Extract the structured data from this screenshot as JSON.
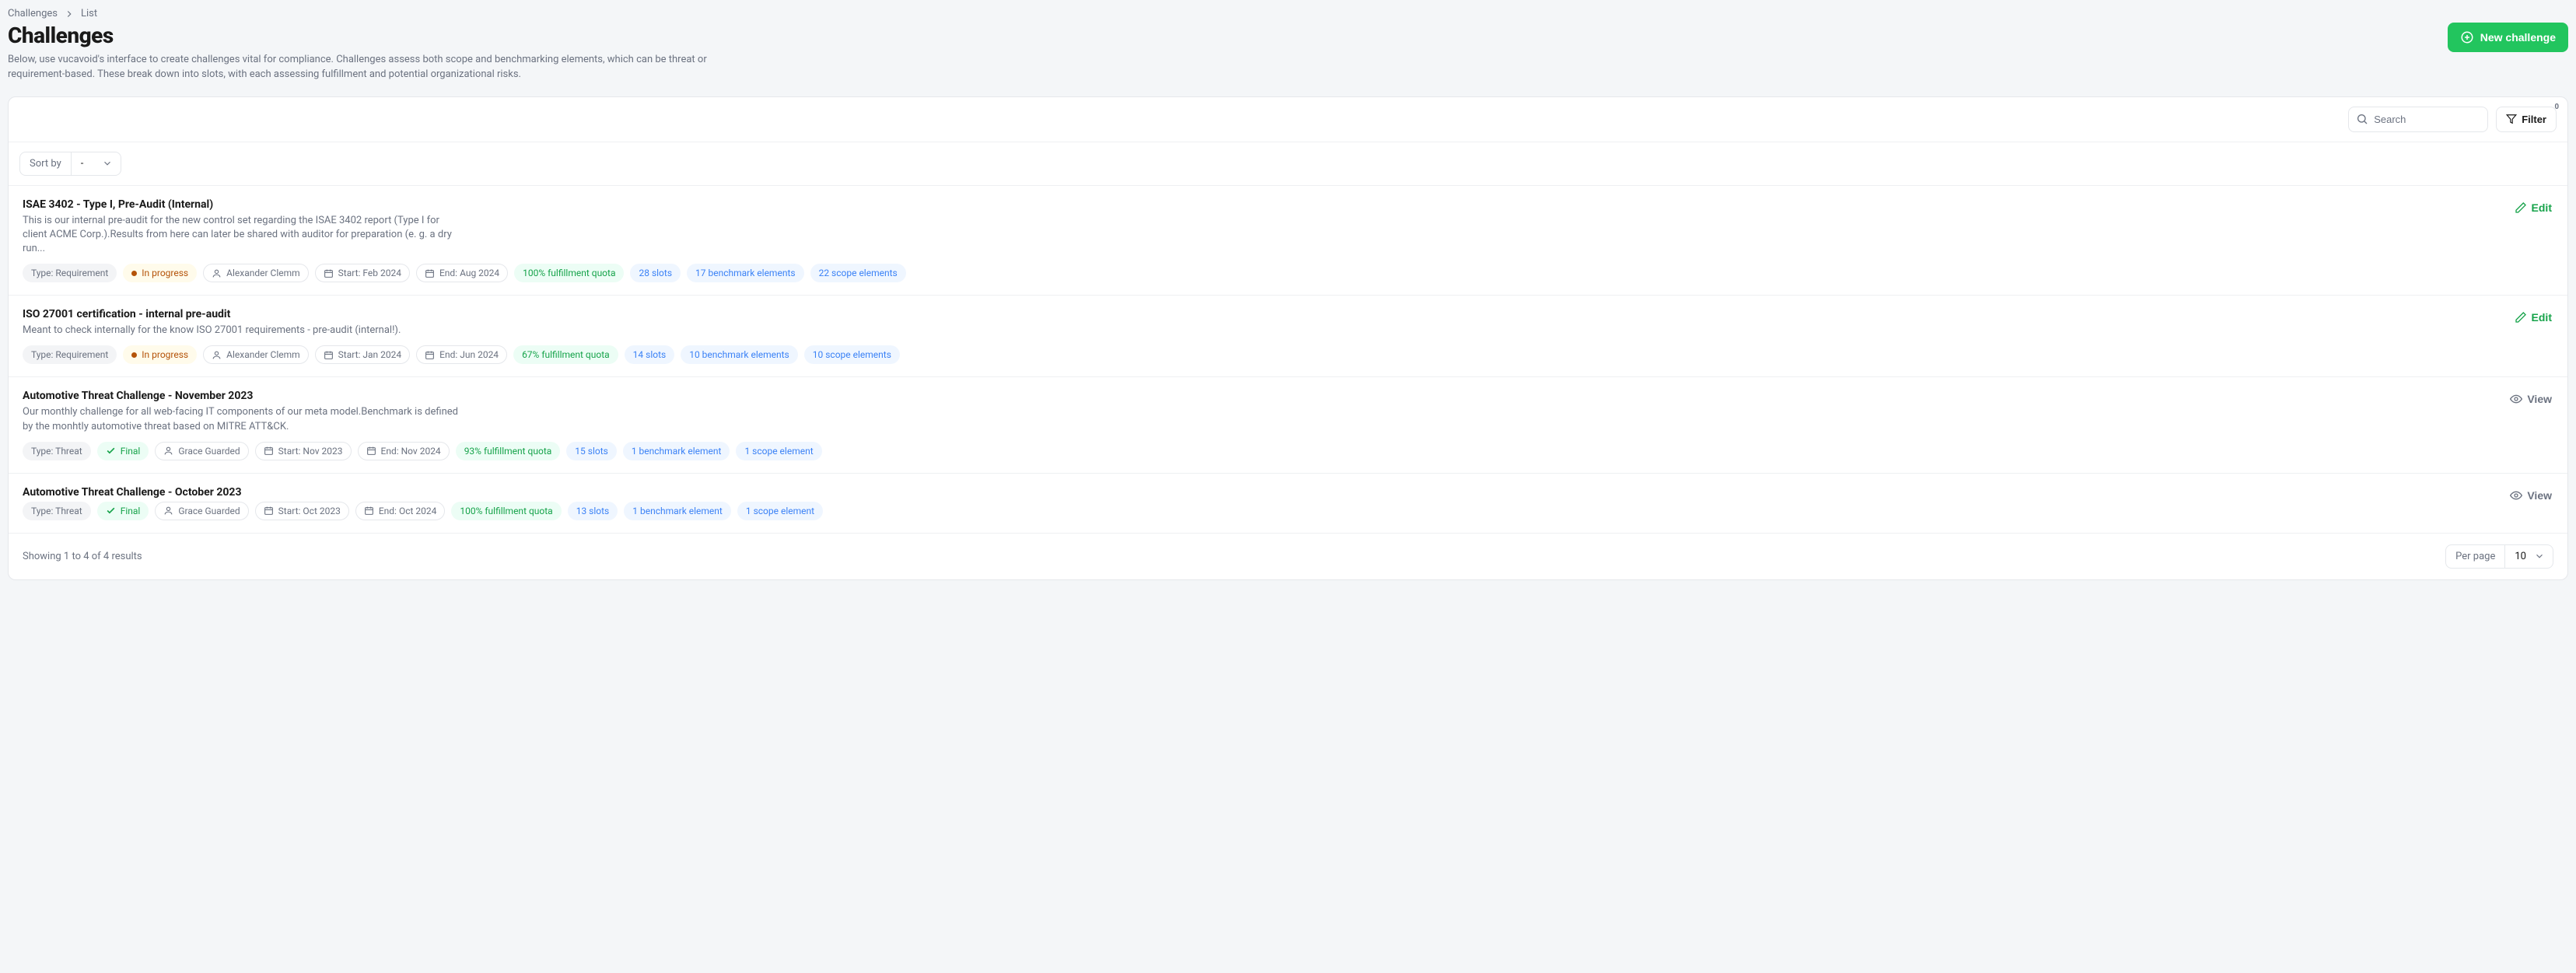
{
  "breadcrumb": {
    "root": "Challenges",
    "current": "List"
  },
  "header": {
    "title": "Challenges",
    "description": "Below, use vucavoid's interface to create challenges vital for compliance. Challenges assess both scope and benchmarking elements, which can be threat or requirement-based. These break down into slots, with each assessing fulfillment and potential organizational risks.",
    "new_button": "New challenge"
  },
  "toolbar": {
    "search_placeholder": "Search",
    "filter_label": "Filter",
    "filter_count": "0"
  },
  "sort": {
    "label": "Sort by",
    "selected": "-"
  },
  "actions": {
    "edit": "Edit",
    "view": "View"
  },
  "items": [
    {
      "title": "ISAE 3402 - Type I, Pre-Audit (Internal)",
      "description": "This is our internal pre-audit for the new control set regarding the ISAE 3402 report (Type I for client ACME Corp.).Results from here can later be shared with auditor for preparation (e. g. a dry run...",
      "type_label": "Type: Requirement",
      "status": {
        "kind": "progress",
        "label": "In progress"
      },
      "author": "Alexander Clemm",
      "start": "Start: Feb 2024",
      "end": "End: Aug 2024",
      "quota": "100% fulfillment quota",
      "slots": "28 slots",
      "benchmark": "17 benchmark elements",
      "scope": "22 scope elements",
      "action": "edit"
    },
    {
      "title": "ISO 27001 certification - internal pre-audit",
      "description": "Meant to check internally for the know ISO 27001 requirements - pre-audit (internal!).",
      "type_label": "Type: Requirement",
      "status": {
        "kind": "progress",
        "label": "In progress"
      },
      "author": "Alexander Clemm",
      "start": "Start: Jan 2024",
      "end": "End: Jun 2024",
      "quota": "67% fulfillment quota",
      "slots": "14 slots",
      "benchmark": "10 benchmark elements",
      "scope": "10 scope elements",
      "action": "edit"
    },
    {
      "title": "Automotive Threat Challenge - November 2023",
      "description": "Our monthly challenge for all web-facing IT components of our meta model.Benchmark is defined by the monhtly automotive threat based on MITRE ATT&CK.",
      "type_label": "Type: Threat",
      "status": {
        "kind": "final",
        "label": "Final"
      },
      "author": "Grace Guarded",
      "start": "Start: Nov 2023",
      "end": "End: Nov 2024",
      "quota": "93% fulfillment quota",
      "slots": "15 slots",
      "benchmark": "1 benchmark element",
      "scope": "1 scope element",
      "action": "view"
    },
    {
      "title": "Automotive Threat Challenge - October 2023",
      "description": "",
      "type_label": "Type: Threat",
      "status": {
        "kind": "final",
        "label": "Final"
      },
      "author": "Grace Guarded",
      "start": "Start: Oct 2023",
      "end": "End: Oct 2024",
      "quota": "100% fulfillment quota",
      "slots": "13 slots",
      "benchmark": "1 benchmark element",
      "scope": "1 scope element",
      "action": "view"
    }
  ],
  "footer": {
    "results_text": "Showing 1 to 4 of 4 results",
    "per_page_label": "Per page",
    "per_page_value": "10"
  }
}
